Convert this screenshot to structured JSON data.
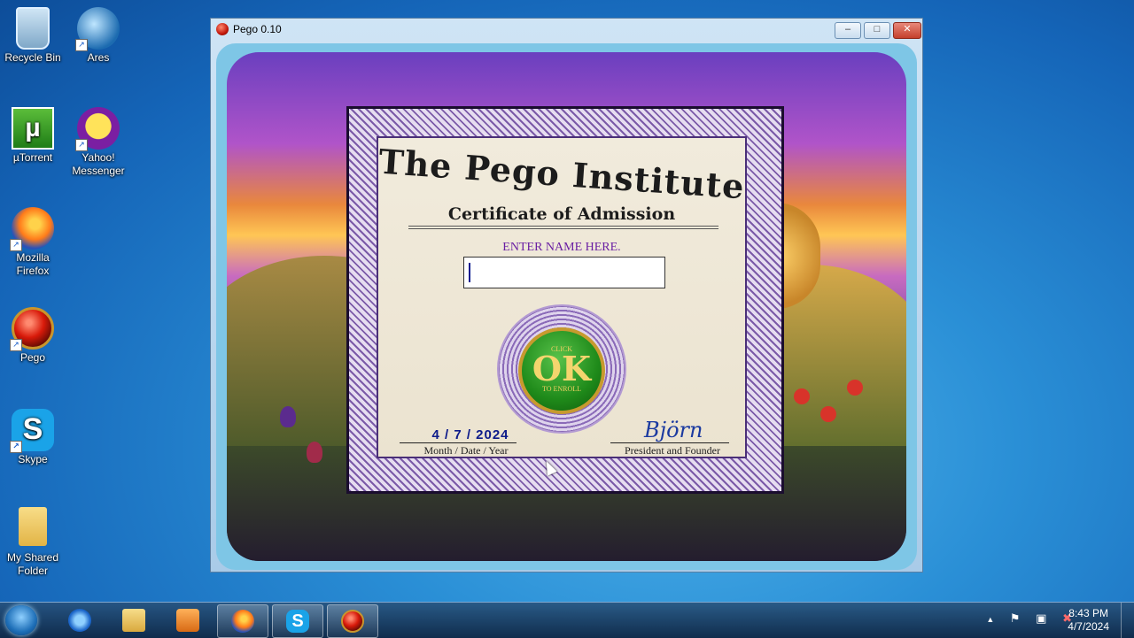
{
  "desktop": {
    "icons": [
      {
        "label": "Recycle Bin"
      },
      {
        "label": "Ares"
      },
      {
        "label": "µTorrent"
      },
      {
        "label": "Yahoo! Messenger"
      },
      {
        "label": "Mozilla Firefox"
      },
      {
        "label": "Pego"
      },
      {
        "label": "Skype"
      },
      {
        "label": "My Shared Folder"
      }
    ]
  },
  "window": {
    "title": "Pego 0.10",
    "minimize": "–",
    "maximize": "□",
    "close": "✕"
  },
  "certificate": {
    "institute": "The Pego Institute",
    "subtitle": "Certificate of Admission",
    "prompt": "ENTER NAME HERE.",
    "name_value": "",
    "ok_top": "CLICK",
    "ok_main": "OK",
    "ok_bottom": "TO ENROLL",
    "date_value": "4 / 7 / 2024",
    "date_label": "Month / Date / Year",
    "signature": "Björn",
    "signer_label": "President and Founder"
  },
  "taskbar": {
    "items": [
      "internet-explorer",
      "windows-explorer",
      "media-player",
      "firefox",
      "skype",
      "pego"
    ],
    "tray_up": "▲",
    "flag": "⚑",
    "network": "▣",
    "volume": "✖",
    "time": "8:43 PM",
    "date": "4/7/2024"
  }
}
